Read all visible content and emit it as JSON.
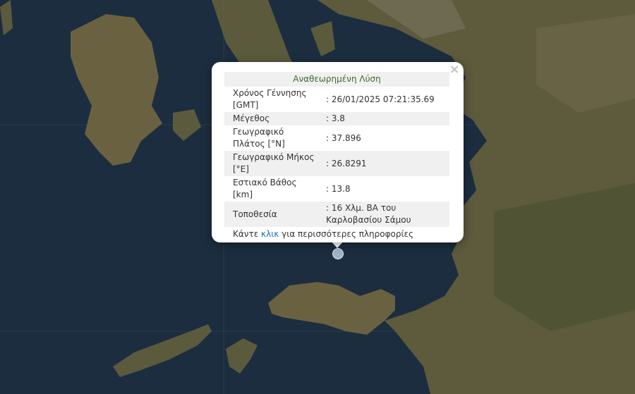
{
  "popup": {
    "title": "Αναθεωρημένη Λύση",
    "close": "×",
    "rows": [
      {
        "label": "Χρόνος Γέννησης [GMT]",
        "value": ": 26/01/2025 07:21:35.69"
      },
      {
        "label": "Μέγεθος",
        "value": ": 3.8"
      },
      {
        "label": "Γεωγραφικό Πλάτος [°N]",
        "value": ": 37.896"
      },
      {
        "label": "Γεωγραφικό Μήκος [°E]",
        "value": ": 26.8291"
      },
      {
        "label": "Εστιακό Βάθος [km]",
        "value": ": 13.8"
      },
      {
        "label": "Τοποθεσία",
        "value": ": 16 Χλμ. ΒΑ του Καρλοβασίου Σάμου"
      }
    ],
    "footer_pre": "Κάντε",
    "footer_link": "κλικ",
    "footer_post": "για περισσότερες πληροφορίες"
  },
  "colors": {
    "sea": "#1c2d3f",
    "land": "#5e5a3c",
    "title_green": "#3b6b2a",
    "link_blue": "#1f6fb5"
  },
  "icons": {
    "epicenter_marker": "epicenter-marker-icon",
    "close": "close-icon"
  }
}
